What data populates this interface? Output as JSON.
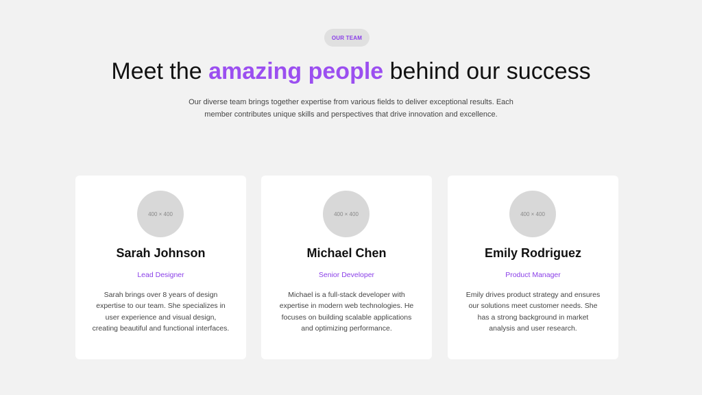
{
  "section": {
    "badge": "OUR TEAM",
    "headline": {
      "before": "Meet the ",
      "accent": "amazing people",
      "after": " behind our success"
    },
    "intro": "Our diverse team brings together expertise from various fields to deliver exceptional results. Each member contributes unique skills and perspectives that drive innovation and excellence."
  },
  "team": [
    {
      "avatar_placeholder": "400 × 400",
      "name": "Sarah Johnson",
      "role": "Lead Designer",
      "bio": "Sarah brings over 8 years of design expertise to our team. She specializes in user experience and visual design, creating beautiful and functional interfaces."
    },
    {
      "avatar_placeholder": "400 × 400",
      "name": "Michael Chen",
      "role": "Senior Developer",
      "bio": "Michael is a full-stack developer with expertise in modern web technologies. He focuses on building scalable applications and optimizing performance."
    },
    {
      "avatar_placeholder": "400 × 400",
      "name": "Emily Rodriguez",
      "role": "Product Manager",
      "bio": "Emily drives product strategy and ensures our solutions meet customer needs. She has a strong background in market analysis and user research."
    }
  ],
  "colors": {
    "background": "#f2f2f2",
    "accent": "#9b4ff0",
    "badge_background": "#e0e0e0",
    "card_background": "#ffffff",
    "avatar_placeholder": "#d8d8d8"
  }
}
